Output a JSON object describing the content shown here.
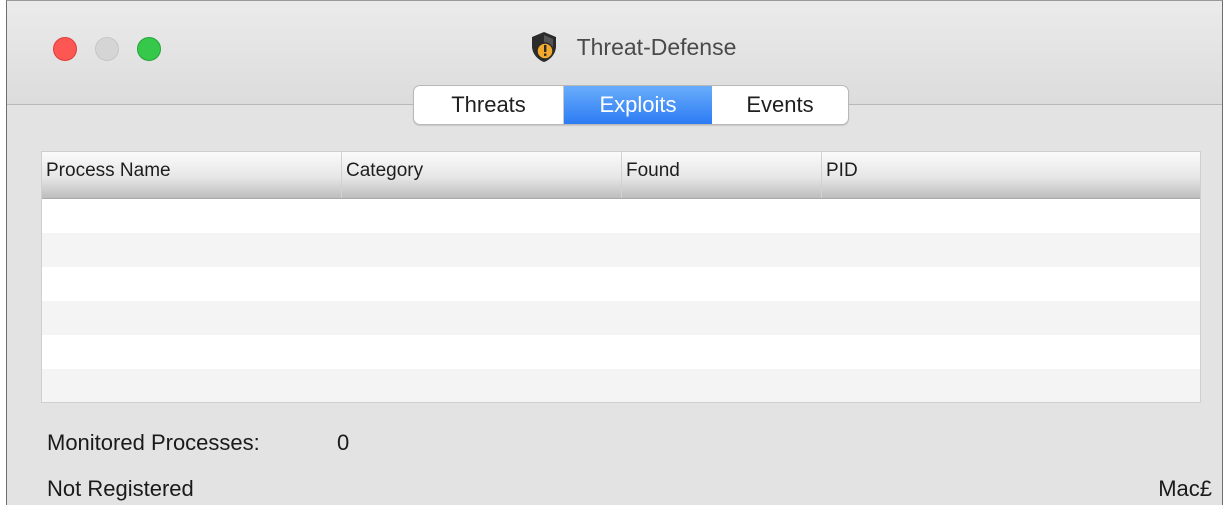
{
  "window": {
    "title": "Threat-Defense"
  },
  "tabs": [
    {
      "label": "Threats",
      "selected": false
    },
    {
      "label": "Exploits",
      "selected": true
    },
    {
      "label": "Events",
      "selected": false
    }
  ],
  "table": {
    "columns": [
      "Process Name",
      "Category",
      "Found",
      "PID"
    ],
    "rows": []
  },
  "footer": {
    "monitored_label": "Monitored Processes:",
    "monitored_count": "0",
    "registration_status": "Not Registered",
    "brand_text": "Mac£"
  },
  "colors": {
    "accent": "#2c7bf4",
    "close": "#fc5753",
    "minimize": "#d5d5d5",
    "zoom": "#35c84a"
  }
}
